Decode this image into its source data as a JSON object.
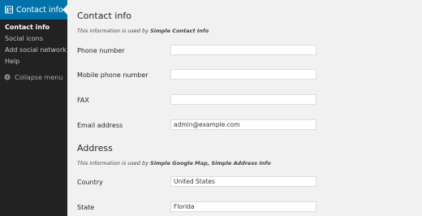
{
  "sidebar": {
    "menu_title": "Contact info",
    "submenu": [
      {
        "label": "Contact info"
      },
      {
        "label": "Social icons"
      },
      {
        "label": "Add social network"
      },
      {
        "label": "Help"
      }
    ],
    "collapse_label": "Collapse menu"
  },
  "contact": {
    "heading": "Contact info",
    "desc_prefix": "This information is used by",
    "desc_source": "Simple Contact Info",
    "fields": [
      {
        "label": "Phone number",
        "value": ""
      },
      {
        "label": "Mobile phone number",
        "value": ""
      },
      {
        "label": "FAX",
        "value": ""
      },
      {
        "label": "Email address",
        "value": "admin@example.com"
      }
    ]
  },
  "address": {
    "heading": "Address",
    "desc_prefix": "This information is used by",
    "desc_source": "Simple Google Map, Simple Address Info",
    "fields": [
      {
        "label": "Country",
        "value": "United States"
      },
      {
        "label": "State",
        "value": "Florida"
      }
    ]
  },
  "colors": {
    "sidebar_bg": "#222222",
    "active_menu_bg": "#0073aa",
    "page_bg": "#f1f1f1"
  }
}
